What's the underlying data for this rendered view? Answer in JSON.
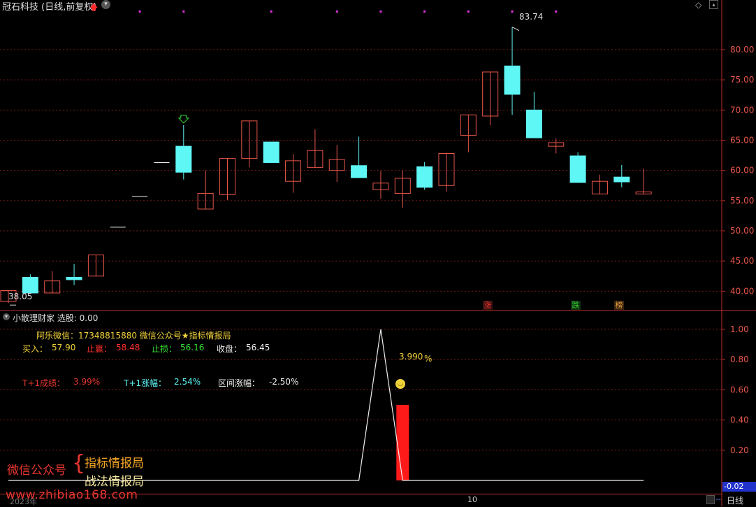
{
  "header": {
    "title": "冠石科技 (日线,前复权)",
    "max_label": "83.74",
    "min_label": "38.05"
  },
  "indicator": {
    "title": "小散理财家 选股: 0.00",
    "wechat_line": "阿乐微信：17348815880   微信公众号★指标情报局",
    "buy_label": "买入：",
    "buy_value": "57.90",
    "tp_label": "止赢：",
    "tp_value": "58.48",
    "sl_label": "止损：",
    "sl_value": "56.16",
    "close_label": "收盘：",
    "close_value": "56.45",
    "t1_success_label": "T+1成绩：",
    "t1_success_value": "3.99%",
    "t1_rise_label": "T+1涨幅：",
    "t1_rise_value": "2.54%",
    "range_label": "区间涨幅：",
    "range_value": "-2.50%",
    "peak_label": "3.990",
    "peak_unit": "%",
    "current_value": "-0.02"
  },
  "watermark": {
    "left": "微信公众号",
    "right1": "指标情报局",
    "right2": "战法情报局",
    "url": "www.zhibiao168.com"
  },
  "bottom": {
    "year": "2023年",
    "month_tick": "10",
    "period_tab": "日线",
    "dash": "--"
  },
  "badges": [
    {
      "char": "涨",
      "color": "#e8372f"
    },
    {
      "char": "跌",
      "color": "#35d435"
    },
    {
      "char": "榜",
      "color": "#e8a040"
    }
  ],
  "colors": {
    "up": "#e8564a",
    "down": "#5ff6f6",
    "grid": "#7a1c1c",
    "axis": "#c0302a",
    "axis_text": "#e8564a"
  },
  "chart_data": [
    {
      "type": "candlestick",
      "title": "冠石科技 (日线,前复权)",
      "y_ticks": [
        40,
        45,
        50,
        55,
        60,
        65,
        70,
        75,
        80
      ],
      "ylim": [
        36.8,
        86.6
      ],
      "grid": true,
      "candles": [
        {
          "o": 38.3,
          "c": 40.1,
          "h": 40.1,
          "l": 38.05
        },
        {
          "o": 42.3,
          "c": 39.7,
          "h": 42.8,
          "l": 39.7
        },
        {
          "o": 39.7,
          "c": 41.7,
          "h": 43.3,
          "l": 39.7
        },
        {
          "o": 42.3,
          "c": 41.9,
          "h": 44.5,
          "l": 41.0
        },
        {
          "o": 42.5,
          "c": 46.0,
          "h": 46.0,
          "l": 42.5
        },
        {
          "o": 50.6,
          "c": 50.6,
          "h": 50.6,
          "l": 50.6
        },
        {
          "o": 55.7,
          "c": 55.7,
          "h": 55.7,
          "l": 55.7
        },
        {
          "o": 61.3,
          "c": 61.3,
          "h": 61.3,
          "l": 61.3
        },
        {
          "o": 64.0,
          "c": 59.7,
          "h": 67.5,
          "l": 58.5
        },
        {
          "o": 53.6,
          "c": 56.2,
          "h": 60.0,
          "l": 53.6
        },
        {
          "o": 56.0,
          "c": 62.0,
          "h": 62.0,
          "l": 55.1
        },
        {
          "o": 62.0,
          "c": 68.2,
          "h": 68.2,
          "l": 60.5
        },
        {
          "o": 64.7,
          "c": 61.3,
          "h": 64.7,
          "l": 61.3
        },
        {
          "o": 58.2,
          "c": 61.6,
          "h": 62.7,
          "l": 56.3
        },
        {
          "o": 60.5,
          "c": 63.3,
          "h": 66.8,
          "l": 60.5
        },
        {
          "o": 60.0,
          "c": 61.8,
          "h": 64.2,
          "l": 58.1
        },
        {
          "o": 60.8,
          "c": 58.8,
          "h": 65.6,
          "l": 58.8
        },
        {
          "o": 56.8,
          "c": 57.9,
          "h": 59.9,
          "l": 55.3
        },
        {
          "o": 56.2,
          "c": 58.7,
          "h": 60.0,
          "l": 53.8
        },
        {
          "o": 60.6,
          "c": 57.2,
          "h": 61.4,
          "l": 56.8
        },
        {
          "o": 57.5,
          "c": 62.8,
          "h": 62.8,
          "l": 56.5
        },
        {
          "o": 65.8,
          "c": 69.2,
          "h": 69.2,
          "l": 63.0
        },
        {
          "o": 69.0,
          "c": 76.3,
          "h": 76.3,
          "l": 67.5
        },
        {
          "o": 77.3,
          "c": 72.6,
          "h": 83.74,
          "l": 69.2
        },
        {
          "o": 70.0,
          "c": 65.4,
          "h": 73.0,
          "l": 65.4
        },
        {
          "o": 64.0,
          "c": 64.6,
          "h": 65.3,
          "l": 62.8
        },
        {
          "o": 62.4,
          "c": 58.0,
          "h": 63.0,
          "l": 58.0
        },
        {
          "o": 56.1,
          "c": 58.2,
          "h": 59.3,
          "l": 56.1
        },
        {
          "o": 58.9,
          "c": 58.1,
          "h": 60.9,
          "l": 57.2
        },
        {
          "o": 56.1,
          "c": 56.45,
          "h": 60.3,
          "l": 56.1
        }
      ]
    },
    {
      "type": "line",
      "title": "小散理财家",
      "y_ticks": [
        0.2,
        0.4,
        0.6,
        0.8,
        1.0
      ],
      "ylim": [
        -0.06,
        1.05
      ],
      "grid": true,
      "series": [
        {
          "points": [
            [
              0,
              0.0
            ],
            [
              1,
              0.0
            ],
            [
              2,
              0.0
            ],
            [
              3,
              0.0
            ],
            [
              4,
              0.0
            ],
            [
              5,
              0.0
            ],
            [
              6,
              0.0
            ],
            [
              7,
              0.0
            ],
            [
              8,
              0.0
            ],
            [
              9,
              0.0
            ],
            [
              10,
              0.0
            ],
            [
              11,
              0.0
            ],
            [
              12,
              0.0
            ],
            [
              13,
              0.0
            ],
            [
              14,
              0.0
            ],
            [
              15,
              0.0
            ],
            [
              16,
              0.0
            ],
            [
              17,
              1.0
            ],
            [
              18,
              0.0
            ],
            [
              19,
              0.0
            ],
            [
              20,
              0.0
            ],
            [
              21,
              0.0
            ],
            [
              22,
              0.0
            ],
            [
              23,
              0.0
            ],
            [
              24,
              0.0
            ],
            [
              25,
              0.0
            ],
            [
              26,
              0.0
            ],
            [
              27,
              0.0
            ],
            [
              28,
              0.0
            ],
            [
              29,
              0.0
            ]
          ]
        }
      ],
      "bars": [
        {
          "x": 18,
          "value": 0.5,
          "color": "#ff1a1a"
        }
      ]
    }
  ]
}
